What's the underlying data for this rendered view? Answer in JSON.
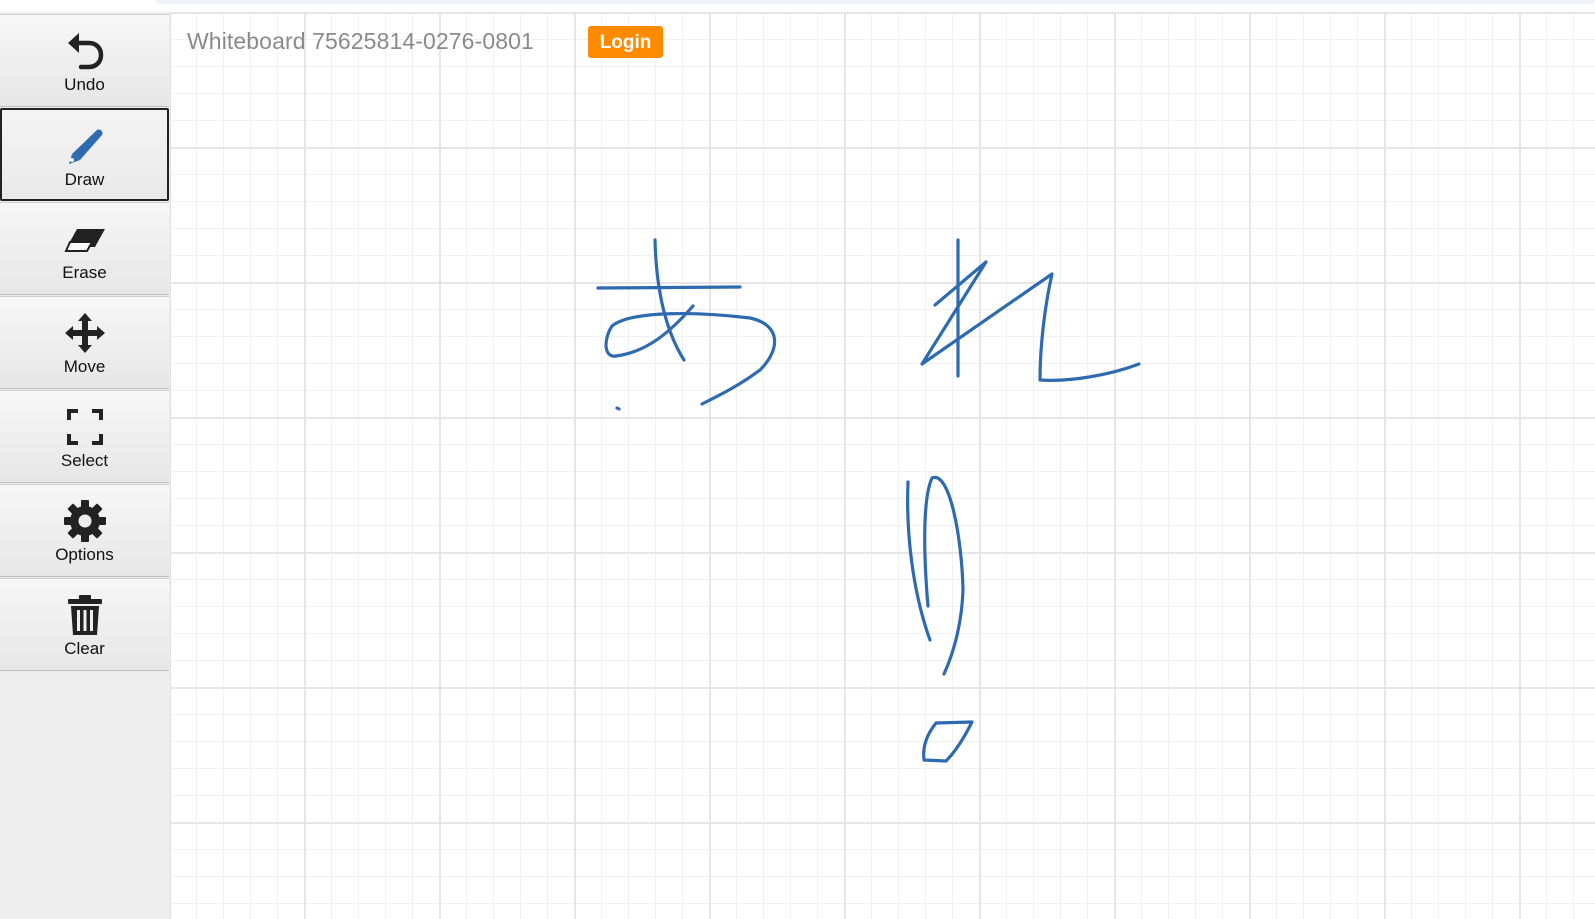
{
  "app": {
    "title": "Whiteboard 75625814-0276-0801",
    "login_label": "Login"
  },
  "colors": {
    "stroke": "#2e6aaf",
    "accent": "#ff8a00",
    "active_tool": "Draw"
  },
  "toolbar": {
    "undo": {
      "label": "Undo",
      "icon": "undo-icon"
    },
    "draw": {
      "label": "Draw",
      "icon": "pencil-icon"
    },
    "erase": {
      "label": "Erase",
      "icon": "eraser-icon"
    },
    "move": {
      "label": "Move",
      "icon": "move-icon"
    },
    "select": {
      "label": "Select",
      "icon": "select-icon"
    },
    "options": {
      "label": "Options",
      "icon": "gear-icon"
    },
    "clear": {
      "label": "Clear",
      "icon": "trash-icon"
    }
  }
}
